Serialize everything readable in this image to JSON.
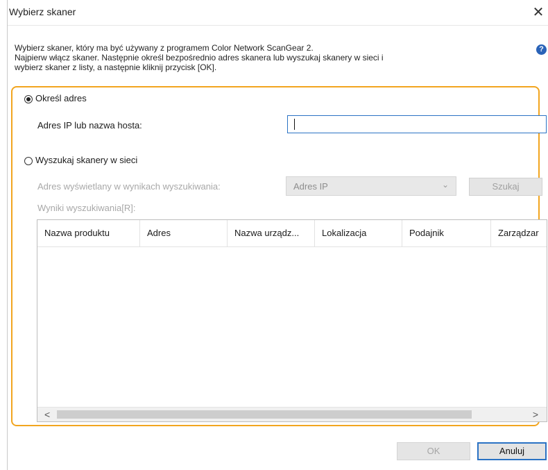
{
  "window": {
    "title": "Wybierz skaner",
    "close_glyph": "✕"
  },
  "intro": {
    "line1": "Wybierz skaner, który ma być używany z programem Color Network ScanGear 2.",
    "line2": "Najpierw włącz skaner. Następnie określ bezpośrednio adres skanera lub wyszukaj skanery w sieci i",
    "line3": "wybierz skaner z listy, a następnie kliknij przycisk [OK]."
  },
  "help": {
    "icon": "help-icon",
    "glyph": "?"
  },
  "option_address": {
    "radio_label": "Określ adres",
    "selected": true,
    "field_label": "Adres IP lub nazwa hosta:",
    "field_value": ""
  },
  "option_search": {
    "radio_label": "Wyszukaj skanery w sieci",
    "selected": false,
    "display_label": "Adres wyświetlany w wynikach wyszukiwania:",
    "display_value": "Adres IP",
    "search_button": "Szukaj",
    "results_label": "Wyniki wyszukiwania[R]:"
  },
  "table": {
    "columns": [
      "Nazwa produktu",
      "Adres",
      "Nazwa urządz...",
      "Lokalizacja",
      "Podajnik",
      "Zarządzar"
    ],
    "rows": [],
    "scroll_left": "<",
    "scroll_right": ">"
  },
  "footer": {
    "ok": "OK",
    "cancel": "Anuluj"
  },
  "colors": {
    "accent_frame": "#f2a51f",
    "focus_blue": "#2a72c4",
    "help_blue": "#2a63b8"
  }
}
